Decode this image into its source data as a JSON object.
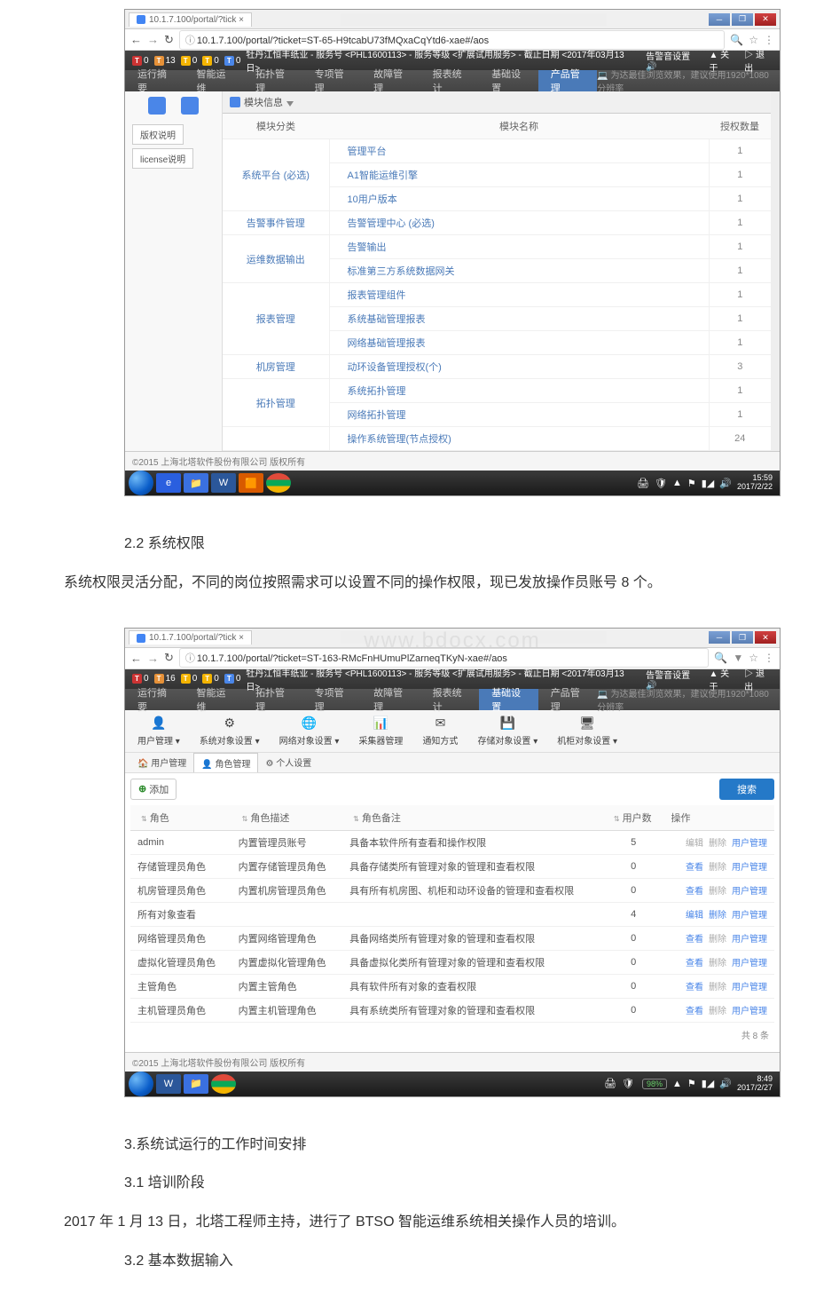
{
  "doc": {
    "heading_22": "2.2 系统权限",
    "para_22": "系统权限灵活分配，不同的岗位按照需求可以设置不同的操作权限，现已发放操作员账号 8 个。",
    "heading_3": "3.系统试运行的工作时间安排",
    "heading_31": "3.1 培训阶段",
    "para_31": "2017 年 1 月 13 日，北塔工程师主持，进行了 BTSO 智能运维系统相关操作人员的培训。",
    "heading_32": "3.2 基本数据输入"
  },
  "shot1": {
    "tab": "10.1.7.100/portal/?tick ×",
    "url": "10.1.7.100/portal/?ticket=ST-65-H9tcabU73fMQxaCqYtd6-xae#/aos",
    "indicators": [
      {
        "l": "T",
        "n": "0"
      },
      {
        "l": "T",
        "n": "13"
      },
      {
        "l": "T",
        "n": "0"
      },
      {
        "l": "T",
        "n": "0"
      },
      {
        "l": "T",
        "n": "0"
      }
    ],
    "server_info": "牡丹江恒丰纸业 - 服务号 <PHL1600113> - 服务等级 <扩展试用服务> - 截止日期 <2017年03月13日>",
    "header_right": {
      "alerts": "告警音设置 🔊",
      "about": "▲ 关于",
      "exit": "▷ 退出"
    },
    "nav": [
      "运行摘要",
      "智能运维",
      "拓扑管理",
      "专项管理",
      "故障管理",
      "报表统计",
      "基础设置",
      "产品管理"
    ],
    "nav_active": 7,
    "nav_tip": "💻 为达最佳浏览效果，建议使用1920*1080分辨率",
    "side_tabs": [
      "版权说明",
      "license说明"
    ],
    "panel_title": "模块信息",
    "columns": [
      "模块分类",
      "模块名称",
      "授权数量"
    ],
    "rows": [
      {
        "cat": "系统平台 (必选)",
        "span": 3,
        "items": [
          [
            "管理平台",
            "1"
          ],
          [
            "A1智能运维引擎",
            "1"
          ],
          [
            "10用户版本",
            "1"
          ]
        ]
      },
      {
        "cat": "告警事件管理",
        "span": 1,
        "items": [
          [
            "告警管理中心 (必选)",
            "1"
          ]
        ]
      },
      {
        "cat": "运维数据输出",
        "span": 2,
        "items": [
          [
            "告警输出",
            "1"
          ],
          [
            "标准第三方系统数据网关",
            "1"
          ]
        ]
      },
      {
        "cat": "报表管理",
        "span": 3,
        "items": [
          [
            "报表管理组件",
            "1"
          ],
          [
            "系统基础管理报表",
            "1"
          ],
          [
            "网络基础管理报表",
            "1"
          ]
        ]
      },
      {
        "cat": "机房管理",
        "span": 1,
        "items": [
          [
            "动环设备管理授权(个)",
            "3"
          ]
        ]
      },
      {
        "cat": "拓扑管理",
        "span": 2,
        "items": [
          [
            "系统拓扑管理",
            "1"
          ],
          [
            "网络拓扑管理",
            "1"
          ]
        ]
      },
      {
        "cat": "",
        "span": 1,
        "items": [
          [
            "操作系统管理(节点授权)",
            "24"
          ]
        ]
      }
    ],
    "footer": "©2015 上海北塔软件股份有限公司 版权所有",
    "clock": {
      "time": "15:59",
      "date": "2017/2/22"
    }
  },
  "shot2": {
    "tab": "10.1.7.100/portal/?tick ×",
    "url": "10.1.7.100/portal/?ticket=ST-163-RMcFnHUmuPlZarneqTKyN-xae#/aos",
    "indicators": [
      {
        "l": "T",
        "n": "0"
      },
      {
        "l": "T",
        "n": "16"
      },
      {
        "l": "T",
        "n": "0"
      },
      {
        "l": "T",
        "n": "0"
      },
      {
        "l": "T",
        "n": "0"
      }
    ],
    "server_info": "牡丹江恒丰纸业 - 服务号 <PHL1600113> - 服务等级 <扩展试用服务> - 截止日期 <2017年03月13日>",
    "header_right": {
      "alerts": "告警音设置 🔊",
      "about": "▲ 关于",
      "exit": "▷ 退出"
    },
    "nav": [
      "运行摘要",
      "智能运维",
      "拓扑管理",
      "专项管理",
      "故障管理",
      "报表统计",
      "基础设置",
      "产品管理"
    ],
    "nav_active": 6,
    "nav_tip": "💻 为达最佳浏览效果，建议使用1920*1080分辨率",
    "sub_nav": [
      {
        "icon": "👤",
        "label": "用户管理 ▾"
      },
      {
        "icon": "⚙",
        "label": "系统对象设置 ▾"
      },
      {
        "icon": "🌐",
        "label": "网络对象设置 ▾"
      },
      {
        "icon": "📊",
        "label": "采集器管理"
      },
      {
        "icon": "✉",
        "label": "通知方式"
      },
      {
        "icon": "💾",
        "label": "存储对象设置 ▾"
      },
      {
        "icon": "🖥",
        "label": "机柜对象设置 ▾"
      }
    ],
    "mini_tabs": [
      {
        "icon": "🏠",
        "label": "用户管理"
      },
      {
        "icon": "👤",
        "label": "角色管理"
      },
      {
        "icon": "⚙",
        "label": "个人设置"
      }
    ],
    "mini_active": 1,
    "add_label": "添加",
    "search_label": "搜索",
    "columns": [
      "角色",
      "角色描述",
      "角色备注",
      "用户数",
      "操作"
    ],
    "rows": [
      {
        "role": "admin",
        "desc": "内置管理员账号",
        "note": "具备本软件所有查看和操作权限",
        "users": "5",
        "actions": [
          "编辑",
          "删除",
          "用户管理"
        ],
        "gray": [
          0,
          1
        ]
      },
      {
        "role": "存储管理员角色",
        "desc": "内置存储管理员角色",
        "note": "具备存储类所有管理对象的管理和查看权限",
        "users": "0",
        "actions": [
          "查看",
          "删除",
          "用户管理"
        ],
        "gray": [
          1
        ]
      },
      {
        "role": "机房管理员角色",
        "desc": "内置机房管理员角色",
        "note": "具有所有机房图、机柜和动环设备的管理和查看权限",
        "users": "0",
        "actions": [
          "查看",
          "删除",
          "用户管理"
        ],
        "gray": [
          1
        ]
      },
      {
        "role": "所有对象查看",
        "desc": "",
        "note": "",
        "users": "4",
        "actions": [
          "编辑",
          "删除",
          "用户管理"
        ],
        "gray": []
      },
      {
        "role": "网络管理员角色",
        "desc": "内置网络管理角色",
        "note": "具备网络类所有管理对象的管理和查看权限",
        "users": "0",
        "actions": [
          "查看",
          "删除",
          "用户管理"
        ],
        "gray": [
          1
        ]
      },
      {
        "role": "虚拟化管理员角色",
        "desc": "内置虚拟化管理角色",
        "note": "具备虚拟化类所有管理对象的管理和查看权限",
        "users": "0",
        "actions": [
          "查看",
          "删除",
          "用户管理"
        ],
        "gray": [
          1
        ]
      },
      {
        "role": "主管角色",
        "desc": "内置主管角色",
        "note": "具有软件所有对象的查看权限",
        "users": "0",
        "actions": [
          "查看",
          "删除",
          "用户管理"
        ],
        "gray": [
          1
        ]
      },
      {
        "role": "主机管理员角色",
        "desc": "内置主机管理角色",
        "note": "具有系统类所有管理对象的管理和查看权限",
        "users": "0",
        "actions": [
          "查看",
          "删除",
          "用户管理"
        ],
        "gray": [
          1
        ]
      }
    ],
    "pager": "共 8 条",
    "footer": "©2015 上海北塔软件股份有限公司 版权所有",
    "battery": "98%",
    "clock": {
      "time": "8:49",
      "date": "2017/2/27"
    },
    "watermark": "www.bdocx.com"
  }
}
